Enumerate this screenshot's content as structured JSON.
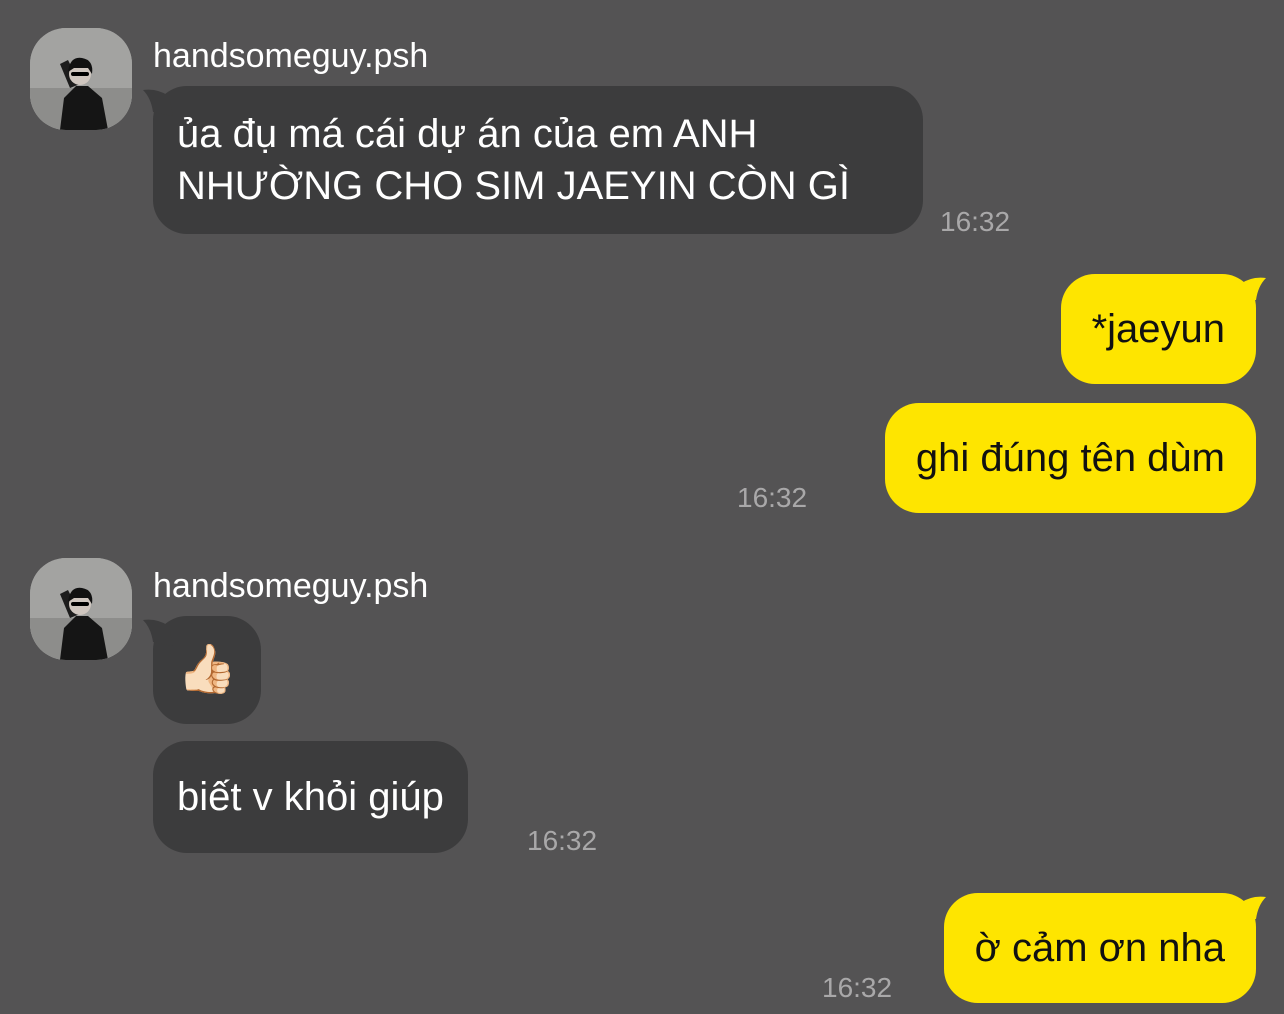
{
  "colors": {
    "background": "#545354",
    "incoming_bubble": "#3c3c3d",
    "outgoing_bubble": "#fee500",
    "incoming_text": "#ffffff",
    "outgoing_text": "#111111",
    "timestamp": "#a9a8a9"
  },
  "conversation": [
    {
      "sender": "handsomeguy.psh",
      "avatar_icon": "profile-photo-icon",
      "messages": [
        {
          "lines": [
            "ủa đụ má cái dự án của em ANH",
            "NHƯỜNG CHO SIM JAEYIN CÒN GÌ"
          ]
        }
      ],
      "time": "16:32"
    },
    {
      "sender": "me",
      "messages": [
        {
          "text": "*jaeyun"
        },
        {
          "text": "ghi đúng tên dùm"
        }
      ],
      "time": "16:32"
    },
    {
      "sender": "handsomeguy.psh",
      "avatar_icon": "profile-photo-icon",
      "messages": [
        {
          "emoji": "👍🏻",
          "emoji_name": "thumbs-up-icon"
        },
        {
          "text": "biết v khỏi giúp"
        }
      ],
      "time": "16:32"
    },
    {
      "sender": "me",
      "messages": [
        {
          "text": "ờ cảm ơn nha"
        }
      ],
      "time": "16:32"
    }
  ]
}
